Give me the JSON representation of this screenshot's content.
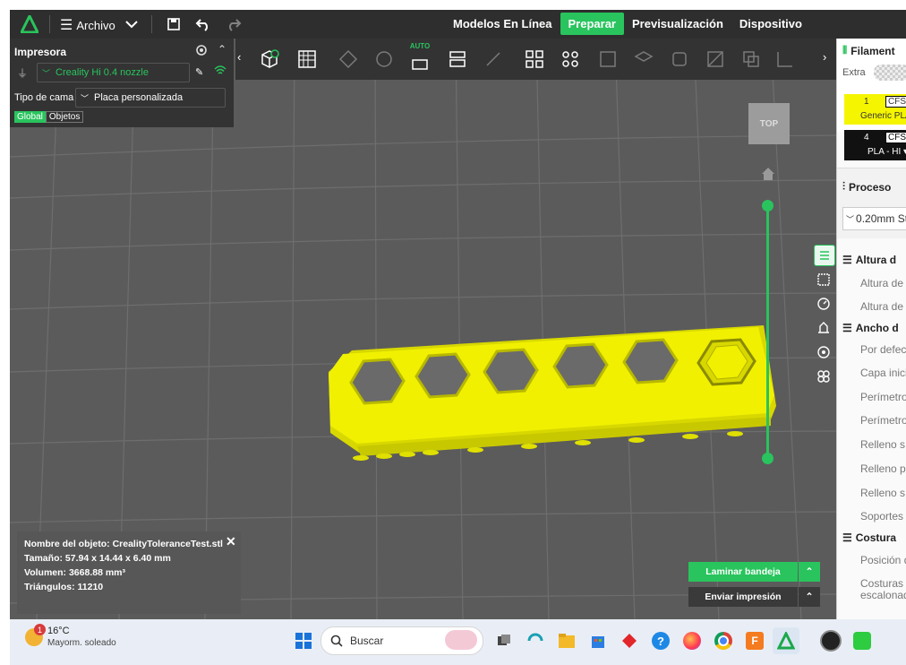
{
  "menu": {
    "archivo": "Archivo"
  },
  "tabs": [
    {
      "label": "Modelos En Línea",
      "active": false
    },
    {
      "label": "Preparar",
      "active": true
    },
    {
      "label": "Previsualización",
      "active": false
    },
    {
      "label": "Dispositivo",
      "active": false
    }
  ],
  "printer": {
    "title": "Impresora",
    "nozzle": "Creality Hi 0.4 nozzle",
    "bed_label": "Tipo de cama",
    "bed_value": "Placa personalizada",
    "scope_global": "Global",
    "scope_objects": "Objetos"
  },
  "toolbar": {
    "auto_label": "AUTO"
  },
  "viewcube": {
    "label": "TOP"
  },
  "model": {
    "color": "#f0f000",
    "hex_count": 6,
    "object_name_label": "Nombre del objeto: CrealityToleranceTest.stl",
    "size_label": "Tamaño: 57.94 x 14.44 x 6.40 mm",
    "volume_label": "Volumen: 3668.88 mm³",
    "triangles_label": "Triángulos: 11210"
  },
  "actions": {
    "slice": "Laminar bandeja",
    "send": "Enviar impresión"
  },
  "right": {
    "filament_title": "Filament",
    "extra": "Extra",
    "slot1_num": "1",
    "slot1_tag": "CFS",
    "slot1_name": "Generic PLA",
    "slot1_color": "#f5f500",
    "slot4_num": "4",
    "slot4_tag": "CFS",
    "slot4_name": "PLA - HI ▾",
    "slot4_color": "#111111",
    "process_title": "Proceso",
    "process_value": "0.20mm St",
    "params": [
      {
        "kind": "head",
        "text": "Altura d"
      },
      {
        "kind": "item",
        "text": "Altura de"
      },
      {
        "kind": "item",
        "text": "Altura de"
      },
      {
        "kind": "head",
        "text": "Ancho d"
      },
      {
        "kind": "item",
        "text": "Por defec"
      },
      {
        "kind": "item",
        "text": "Capa inici"
      },
      {
        "kind": "item",
        "text": "Perímetro"
      },
      {
        "kind": "item",
        "text": "Perímetro"
      },
      {
        "kind": "item",
        "text": "Relleno s"
      },
      {
        "kind": "item",
        "text": "Relleno p"
      },
      {
        "kind": "item",
        "text": "Relleno s"
      },
      {
        "kind": "item",
        "text": "Soportes"
      },
      {
        "kind": "head",
        "text": "Costura"
      },
      {
        "kind": "item",
        "text": "Posición d"
      },
      {
        "kind": "item",
        "text": "Costuras"
      },
      {
        "kind": "item",
        "text": "escalonad"
      }
    ]
  },
  "taskbar": {
    "weather_temp": "16°C",
    "weather_desc": "Mayorm. soleado",
    "notif_count": "1",
    "search_placeholder": "Buscar"
  },
  "colors": {
    "accent": "#29c45d",
    "viewport": "#5b5b5b",
    "dark": "#2e2e2e"
  }
}
